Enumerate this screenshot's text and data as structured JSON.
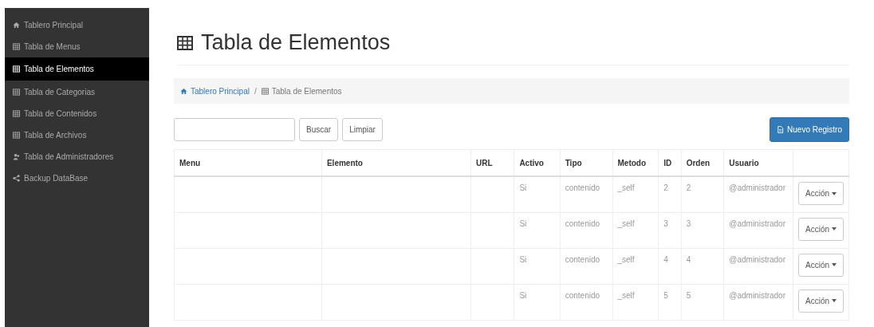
{
  "sidebar": {
    "items": [
      {
        "label": "Tablero Principal",
        "kind": "home",
        "selected": false
      },
      {
        "label": "Tabla de Menus",
        "kind": "table",
        "selected": false
      },
      {
        "label": "Tabla de Elementos",
        "kind": "table",
        "selected": true
      },
      {
        "label": "Tabla de Categorias",
        "kind": "table",
        "selected": false
      },
      {
        "label": "Tabla de Contenidos",
        "kind": "table",
        "selected": false
      },
      {
        "label": "Tabla de Archivos",
        "kind": "table",
        "selected": false
      },
      {
        "label": "Tabla de Administradores",
        "kind": "users",
        "selected": false
      },
      {
        "label": "Backup DataBase",
        "kind": "share",
        "selected": false
      }
    ]
  },
  "page_title": "Tabla de Elementos",
  "breadcrumb": [
    {
      "label": "Tablero Principal",
      "kind": "home"
    },
    {
      "separator": "/"
    },
    {
      "label": "Tabla de Elementos",
      "kind": "table"
    }
  ],
  "toolbar": {
    "search_button": "Buscar",
    "clear_button": "Limpiar",
    "new_button": "Nuevo Registro"
  },
  "table": {
    "columns": [
      "Menu",
      "Elemento",
      "URL",
      "Activo",
      "Tipo",
      "Metodo",
      "ID",
      "Orden",
      "Usuario"
    ],
    "rows": [
      {
        "activo": "Si",
        "tipo": "contenido",
        "metodo": "_self",
        "id": "2",
        "orden": "2",
        "usuario": "@administrador",
        "action": "Acción"
      },
      {
        "activo": "Si",
        "tipo": "contenido",
        "metodo": "_self",
        "id": "3",
        "orden": "3",
        "usuario": "@administrador",
        "action": "Acción"
      },
      {
        "activo": "Si",
        "tipo": "contenido",
        "metodo": "_self",
        "id": "4",
        "orden": "4",
        "usuario": "@administrador",
        "action": "Acción"
      },
      {
        "activo": "Si",
        "tipo": "contenido",
        "metodo": "_self",
        "id": "5",
        "orden": "5",
        "usuario": "@administrador",
        "action": "Acción"
      }
    ]
  }
}
